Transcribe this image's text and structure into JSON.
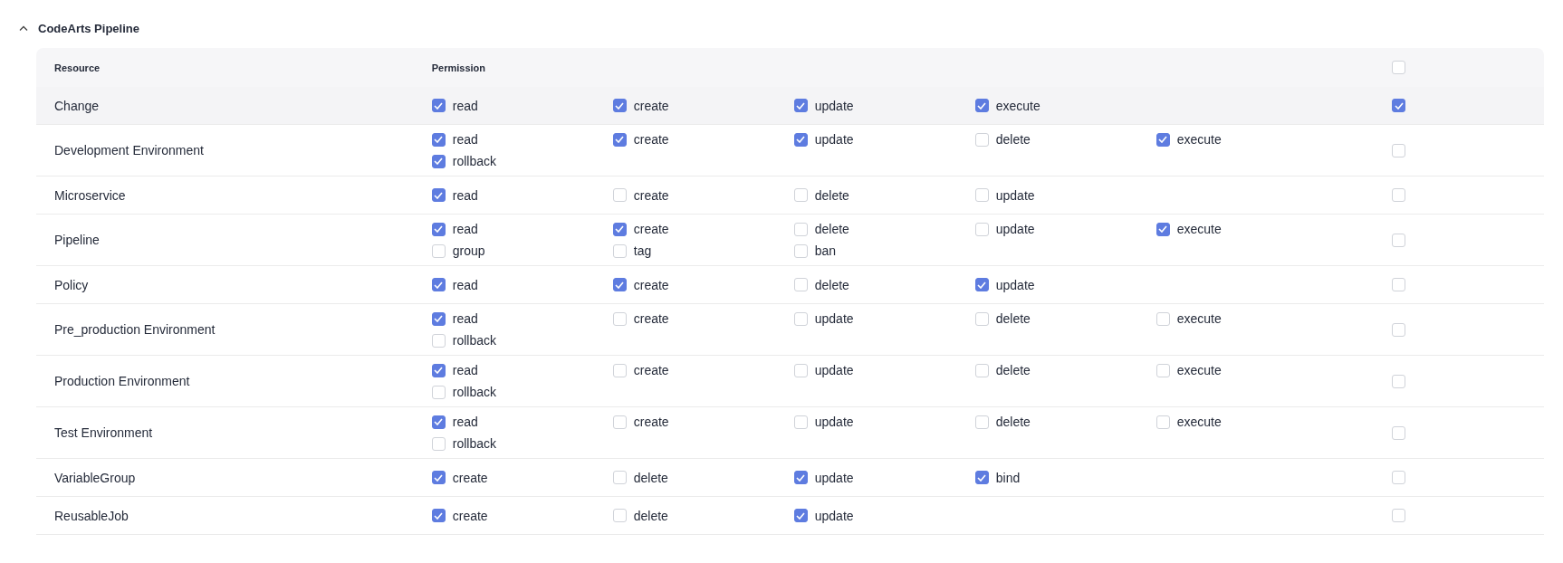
{
  "section": {
    "title": "CodeArts Pipeline",
    "expanded": true
  },
  "table": {
    "columns": [
      "Resource",
      "Permission"
    ],
    "header_checked": false,
    "rows": [
      {
        "resource": "Change",
        "highlighted": true,
        "all_checked": true,
        "permissions": [
          {
            "label": "read",
            "checked": true
          },
          {
            "label": "create",
            "checked": true
          },
          {
            "label": "update",
            "checked": true
          },
          {
            "label": "execute",
            "checked": true
          }
        ]
      },
      {
        "resource": "Development Environment",
        "highlighted": false,
        "all_checked": false,
        "permissions": [
          {
            "label": "read",
            "checked": true
          },
          {
            "label": "create",
            "checked": true
          },
          {
            "label": "update",
            "checked": true
          },
          {
            "label": "delete",
            "checked": false
          },
          {
            "label": "execute",
            "checked": true
          },
          {
            "label": "rollback",
            "checked": true
          }
        ]
      },
      {
        "resource": "Microservice",
        "highlighted": false,
        "all_checked": false,
        "permissions": [
          {
            "label": "read",
            "checked": true
          },
          {
            "label": "create",
            "checked": false
          },
          {
            "label": "delete",
            "checked": false
          },
          {
            "label": "update",
            "checked": false
          }
        ]
      },
      {
        "resource": "Pipeline",
        "highlighted": false,
        "all_checked": false,
        "permissions": [
          {
            "label": "read",
            "checked": true
          },
          {
            "label": "create",
            "checked": true
          },
          {
            "label": "delete",
            "checked": false
          },
          {
            "label": "update",
            "checked": false
          },
          {
            "label": "execute",
            "checked": true
          },
          {
            "label": "group",
            "checked": false
          },
          {
            "label": "tag",
            "checked": false
          },
          {
            "label": "ban",
            "checked": false
          }
        ]
      },
      {
        "resource": "Policy",
        "highlighted": false,
        "all_checked": false,
        "permissions": [
          {
            "label": "read",
            "checked": true
          },
          {
            "label": "create",
            "checked": true
          },
          {
            "label": "delete",
            "checked": false
          },
          {
            "label": "update",
            "checked": true
          }
        ]
      },
      {
        "resource": "Pre_production Environment",
        "highlighted": false,
        "all_checked": false,
        "permissions": [
          {
            "label": "read",
            "checked": true
          },
          {
            "label": "create",
            "checked": false
          },
          {
            "label": "update",
            "checked": false
          },
          {
            "label": "delete",
            "checked": false
          },
          {
            "label": "execute",
            "checked": false
          },
          {
            "label": "rollback",
            "checked": false
          }
        ]
      },
      {
        "resource": "Production Environment",
        "highlighted": false,
        "all_checked": false,
        "permissions": [
          {
            "label": "read",
            "checked": true
          },
          {
            "label": "create",
            "checked": false
          },
          {
            "label": "update",
            "checked": false
          },
          {
            "label": "delete",
            "checked": false
          },
          {
            "label": "execute",
            "checked": false
          },
          {
            "label": "rollback",
            "checked": false
          }
        ]
      },
      {
        "resource": "Test Environment",
        "highlighted": false,
        "all_checked": false,
        "permissions": [
          {
            "label": "read",
            "checked": true
          },
          {
            "label": "create",
            "checked": false
          },
          {
            "label": "update",
            "checked": false
          },
          {
            "label": "delete",
            "checked": false
          },
          {
            "label": "execute",
            "checked": false
          },
          {
            "label": "rollback",
            "checked": false
          }
        ]
      },
      {
        "resource": "VariableGroup",
        "highlighted": false,
        "all_checked": false,
        "permissions": [
          {
            "label": "create",
            "checked": true
          },
          {
            "label": "delete",
            "checked": false
          },
          {
            "label": "update",
            "checked": true
          },
          {
            "label": "bind",
            "checked": true
          }
        ]
      },
      {
        "resource": "ReusableJob",
        "highlighted": false,
        "all_checked": false,
        "permissions": [
          {
            "label": "create",
            "checked": true
          },
          {
            "label": "delete",
            "checked": false
          },
          {
            "label": "update",
            "checked": true
          }
        ]
      }
    ]
  }
}
